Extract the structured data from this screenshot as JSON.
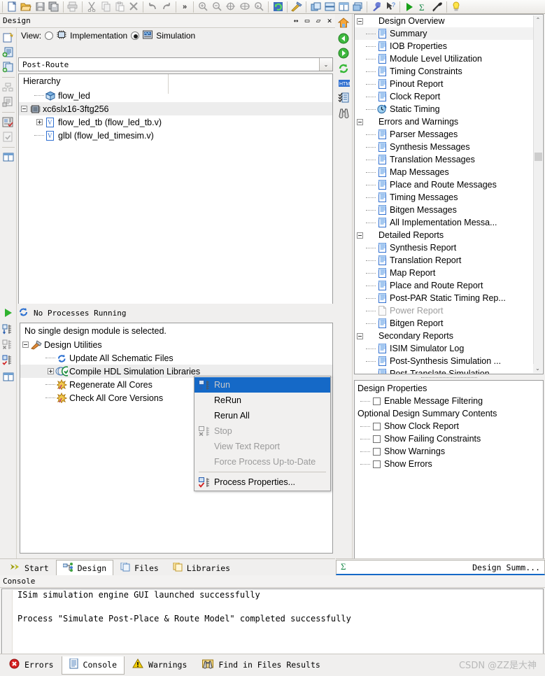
{
  "toolbar": {
    "icons": [
      "new-file-icon",
      "open-folder-icon",
      "save-icon",
      "save-all-icon",
      "print-icon",
      "cut-icon",
      "copy-icon",
      "paste-icon",
      "delete-icon",
      "undo-icon",
      "redo-icon",
      "more-chevron-icon",
      "zoom-in-icon",
      "zoom-out-icon",
      "zoom-fit-icon",
      "zoom-selection-icon",
      "zoom-pointer-icon",
      "refresh-icon",
      "hammer-icon",
      "panel-front-icon",
      "panel-split-icon",
      "panel-columns-icon",
      "panel-stack-icon",
      "wrench-icon",
      "whats-this-icon",
      "run-icon",
      "sum-icon",
      "spyglass-icon",
      "bulb-icon"
    ],
    "more_label": "»"
  },
  "design_panel": {
    "title": "Design",
    "window_buttons": [
      "↔",
      "▭",
      "▱",
      "✕"
    ],
    "view": {
      "label": "View:",
      "implementation": "Implementation",
      "simulation": "Simulation",
      "selected": "Simulation"
    },
    "combo": {
      "value": "Post-Route",
      "arrow": "⌄"
    },
    "hierarchy_label": "Hierarchy",
    "hierarchy": [
      {
        "label": "flow_led",
        "indent": 1,
        "expander": "none",
        "icon": "project-icon",
        "selected": false
      },
      {
        "label": "xc6slx16-3ftg256",
        "indent": 0,
        "expander": "minus",
        "icon": "chip-icon",
        "selected": true
      },
      {
        "label": "flow_led_tb (flow_led_tb.v)",
        "indent": 1,
        "expander": "plus",
        "icon": "verilog-icon",
        "selected": false
      },
      {
        "label": "glbl (flow_led_timesim.v)",
        "indent": 1,
        "expander": "none",
        "icon": "verilog-icon",
        "selected": false
      }
    ],
    "side_icons": [
      "new-source-icon",
      "add-source-icon",
      "add-copy-source-icon",
      "create-schematic-symbol-icon",
      "view-design-summary-icon",
      "design-goals-icon",
      "check-syntax-icon",
      "view-panel-icon"
    ]
  },
  "processes_panel": {
    "status": "No Processes Running",
    "status_icon": "refresh-icon",
    "message": "No single design module is selected.",
    "side_icons": [
      "run-icon",
      "implement-top-module-icon",
      "stop-icon",
      "process-properties-icon",
      "view-panel-icon"
    ],
    "tree": [
      {
        "label": "Design Utilities",
        "indent": 0,
        "expander": "minus",
        "icon": "utilities-icon",
        "selected": false
      },
      {
        "label": "Update All Schematic Files",
        "indent": 1,
        "expander": "none",
        "icon": "refresh-icon",
        "selected": false
      },
      {
        "label": "Compile HDL Simulation Libraries",
        "indent": 1,
        "expander": "plus",
        "icon": "compile-check-icon",
        "selected": true
      },
      {
        "label": "Regenerate All Cores",
        "indent": 1,
        "expander": "none",
        "icon": "core-icon",
        "selected": false
      },
      {
        "label": "Check All Core Versions",
        "indent": 1,
        "expander": "none",
        "icon": "core-icon",
        "selected": false
      }
    ]
  },
  "context_menu": {
    "items": [
      {
        "label": "Run",
        "icon": "run-process-icon",
        "state": "highlighted-disabled"
      },
      {
        "label": "ReRun",
        "icon": "",
        "state": "enabled"
      },
      {
        "label": "Rerun All",
        "icon": "",
        "state": "enabled"
      },
      {
        "label": "Stop",
        "icon": "stop-process-icon",
        "state": "disabled"
      },
      {
        "label": "View Text Report",
        "icon": "",
        "state": "disabled"
      },
      {
        "label": "Force Process Up-to-Date",
        "icon": "",
        "state": "disabled"
      },
      {
        "label": "SEPARATOR",
        "icon": "",
        "state": "separator"
      },
      {
        "label": "Process Properties...",
        "icon": "process-properties-icon",
        "state": "enabled"
      }
    ]
  },
  "summary_panel": {
    "side_icons": [
      "home-icon",
      "back-icon",
      "forward-icon",
      "refresh-icon",
      "html-icon",
      "report-list-icon",
      "binoculars-icon"
    ],
    "tree": [
      {
        "label": "Design Overview",
        "indent": 0,
        "expander": "minus",
        "icon": "",
        "state": "normal"
      },
      {
        "label": "Summary",
        "indent": 1,
        "expander": "none",
        "icon": "doc-icon",
        "state": "selected"
      },
      {
        "label": "IOB Properties",
        "indent": 1,
        "expander": "none",
        "icon": "doc-icon",
        "state": "normal"
      },
      {
        "label": "Module Level Utilization",
        "indent": 1,
        "expander": "none",
        "icon": "doc-icon",
        "state": "normal"
      },
      {
        "label": "Timing Constraints",
        "indent": 1,
        "expander": "none",
        "icon": "doc-icon",
        "state": "normal"
      },
      {
        "label": "Pinout Report",
        "indent": 1,
        "expander": "none",
        "icon": "doc-icon",
        "state": "normal"
      },
      {
        "label": "Clock Report",
        "indent": 1,
        "expander": "none",
        "icon": "doc-icon",
        "state": "normal"
      },
      {
        "label": "Static Timing",
        "indent": 1,
        "expander": "none",
        "icon": "clock-icon",
        "state": "normal"
      },
      {
        "label": "Errors and Warnings",
        "indent": 0,
        "expander": "minus",
        "icon": "",
        "state": "normal"
      },
      {
        "label": "Parser Messages",
        "indent": 1,
        "expander": "none",
        "icon": "doc-icon",
        "state": "normal"
      },
      {
        "label": "Synthesis Messages",
        "indent": 1,
        "expander": "none",
        "icon": "doc-icon",
        "state": "normal"
      },
      {
        "label": "Translation Messages",
        "indent": 1,
        "expander": "none",
        "icon": "doc-icon",
        "state": "normal"
      },
      {
        "label": "Map Messages",
        "indent": 1,
        "expander": "none",
        "icon": "doc-icon",
        "state": "normal"
      },
      {
        "label": "Place and Route Messages",
        "indent": 1,
        "expander": "none",
        "icon": "doc-icon",
        "state": "normal"
      },
      {
        "label": "Timing Messages",
        "indent": 1,
        "expander": "none",
        "icon": "doc-icon",
        "state": "normal"
      },
      {
        "label": "Bitgen Messages",
        "indent": 1,
        "expander": "none",
        "icon": "doc-icon",
        "state": "normal"
      },
      {
        "label": "All Implementation Messa...",
        "indent": 1,
        "expander": "none",
        "icon": "doc-icon",
        "state": "normal"
      },
      {
        "label": "Detailed Reports",
        "indent": 0,
        "expander": "minus",
        "icon": "",
        "state": "normal"
      },
      {
        "label": "Synthesis Report",
        "indent": 1,
        "expander": "none",
        "icon": "doc-icon",
        "state": "normal"
      },
      {
        "label": "Translation Report",
        "indent": 1,
        "expander": "none",
        "icon": "doc-icon",
        "state": "normal"
      },
      {
        "label": "Map Report",
        "indent": 1,
        "expander": "none",
        "icon": "doc-icon",
        "state": "normal"
      },
      {
        "label": "Place and Route Report",
        "indent": 1,
        "expander": "none",
        "icon": "doc-icon",
        "state": "normal"
      },
      {
        "label": "Post-PAR Static Timing Rep...",
        "indent": 1,
        "expander": "none",
        "icon": "doc-icon",
        "state": "normal"
      },
      {
        "label": "Power Report",
        "indent": 1,
        "expander": "none",
        "icon": "doc-blank-icon",
        "state": "disabled"
      },
      {
        "label": "Bitgen Report",
        "indent": 1,
        "expander": "none",
        "icon": "doc-icon",
        "state": "normal"
      },
      {
        "label": "Secondary Reports",
        "indent": 0,
        "expander": "minus",
        "icon": "",
        "state": "normal"
      },
      {
        "label": "ISIM Simulator Log",
        "indent": 1,
        "expander": "none",
        "icon": "doc-icon",
        "state": "normal"
      },
      {
        "label": "Post-Synthesis Simulation ...",
        "indent": 1,
        "expander": "none",
        "icon": "doc-icon",
        "state": "normal"
      },
      {
        "label": "Post-Translate Simulation",
        "indent": 1,
        "expander": "none",
        "icon": "doc-icon",
        "state": "normal"
      }
    ],
    "scroll": {
      "up": "⌃",
      "down": "⌄"
    },
    "properties": {
      "design_properties_label": "Design Properties",
      "optional_contents_label": "Optional Design Summary Contents",
      "checkboxes": [
        {
          "label": "Enable Message Filtering",
          "checked": false,
          "group": "design"
        },
        {
          "label": "Show Clock Report",
          "checked": false,
          "group": "optional"
        },
        {
          "label": "Show Failing Constraints",
          "checked": false,
          "group": "optional"
        },
        {
          "label": "Show Warnings",
          "checked": false,
          "group": "optional"
        },
        {
          "label": "Show Errors",
          "checked": false,
          "group": "optional"
        }
      ]
    },
    "tab_label": "Design Summ...",
    "tab_icon": "sum-icon"
  },
  "bottom_tabs": [
    {
      "label": "Start",
      "icon": "start-icon",
      "active": false
    },
    {
      "label": "Design",
      "icon": "design-icon",
      "active": true
    },
    {
      "label": "Files",
      "icon": "files-icon",
      "active": false
    },
    {
      "label": "Libraries",
      "icon": "libraries-icon",
      "active": false
    }
  ],
  "console": {
    "title": "Console",
    "lines": [
      "ISim simulation engine GUI launched successfully",
      "",
      "Process \"Simulate Post-Place & Route Model\" completed successfully"
    ],
    "hscroll": {
      "left": "‹",
      "right": ""
    }
  },
  "status_tabs": [
    {
      "label": "Errors",
      "icon": "error-icon",
      "active": false
    },
    {
      "label": "Console",
      "icon": "console-icon",
      "active": true
    },
    {
      "label": "Warnings",
      "icon": "warning-icon",
      "active": false
    },
    {
      "label": "Find in Files Results",
      "icon": "find-icon",
      "active": false
    }
  ],
  "watermark": "CSDN @ZZ是大神",
  "colors": {
    "selection_blue": "#1569c7",
    "panel_bg": "#f0efee",
    "accent_green": "#2e9e3e"
  }
}
